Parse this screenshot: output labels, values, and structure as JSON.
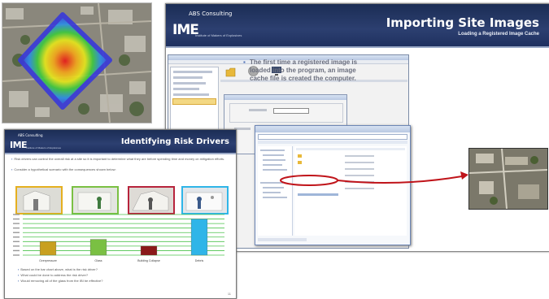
{
  "main_slide": {
    "title": "Importing Site Images",
    "subtitle": "Loading a Registered Image Cache",
    "logo_small": "ABS Consulting",
    "logo_ime": "IME",
    "logo_sub": "Institute of Makers of Explosives",
    "bullet": "The first time a registered image is loaded into the program, an image cache file is created the computer."
  },
  "risk_slide": {
    "title": "Identifying Risk Drivers",
    "logo_small": "ABS Consulting",
    "logo_ime": "IME",
    "logo_sub": "Institute of Makers of Explosives",
    "bullets": [
      "Risk drivers can control the overall risk at a site so it is important to determine what they are before spending time and money on mitigation efforts.",
      "Consider a hypothetical scenario with the consequences shown below:"
    ],
    "questions": [
      "Based on the bar chart above, what is the risk driver?",
      "What could be done to address the risk driver?",
      "Would removing all of the glass from the IBI be effective?"
    ],
    "page_number": "11"
  },
  "chart_data": {
    "type": "bar",
    "categories": [
      "Overpressure",
      "Glass",
      "Building Collapse",
      "Debris"
    ],
    "values": [
      3,
      3.5,
      2,
      8
    ],
    "colors": [
      "#c8a020",
      "#7ac043",
      "#8b1a1a",
      "#2fb5e8"
    ],
    "ylim": [
      0,
      9
    ],
    "ytick_count": 9
  },
  "colors": {
    "banner": "#1f3160",
    "accent": "#4a6eb5",
    "callout": "#c0141a"
  }
}
